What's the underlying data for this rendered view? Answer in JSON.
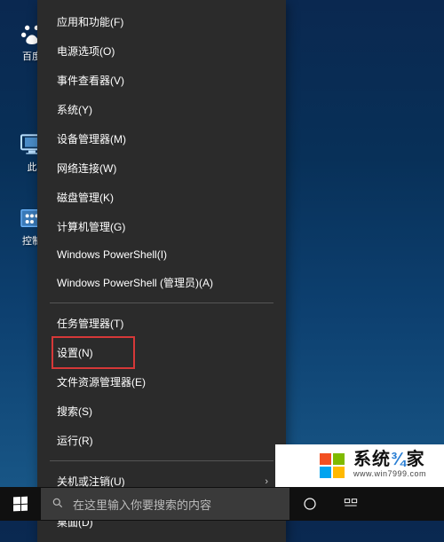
{
  "desktop_icons": [
    {
      "label": "百度"
    },
    {
      "label": "此"
    },
    {
      "label": "控制"
    }
  ],
  "context_menu": {
    "groups": [
      [
        {
          "label": "应用和功能(F)",
          "has_submenu": false
        },
        {
          "label": "电源选项(O)",
          "has_submenu": false
        },
        {
          "label": "事件查看器(V)",
          "has_submenu": false
        },
        {
          "label": "系统(Y)",
          "has_submenu": false
        },
        {
          "label": "设备管理器(M)",
          "has_submenu": false
        },
        {
          "label": "网络连接(W)",
          "has_submenu": false
        },
        {
          "label": "磁盘管理(K)",
          "has_submenu": false
        },
        {
          "label": "计算机管理(G)",
          "has_submenu": false
        },
        {
          "label": "Windows PowerShell(I)",
          "has_submenu": false
        },
        {
          "label": "Windows PowerShell (管理员)(A)",
          "has_submenu": false
        }
      ],
      [
        {
          "label": "任务管理器(T)",
          "has_submenu": false
        },
        {
          "label": "设置(N)",
          "has_submenu": false,
          "highlighted": true
        },
        {
          "label": "文件资源管理器(E)",
          "has_submenu": false
        },
        {
          "label": "搜索(S)",
          "has_submenu": false
        },
        {
          "label": "运行(R)",
          "has_submenu": false
        }
      ],
      [
        {
          "label": "关机或注销(U)",
          "has_submenu": true
        }
      ],
      [
        {
          "label": "桌面(D)",
          "has_submenu": false
        }
      ]
    ]
  },
  "taskbar": {
    "search_placeholder": "在这里输入你要搜索的内容"
  },
  "watermark": {
    "main_prefix": "系统",
    "main_suffix": "家",
    "sub": "www.win7999.com"
  }
}
